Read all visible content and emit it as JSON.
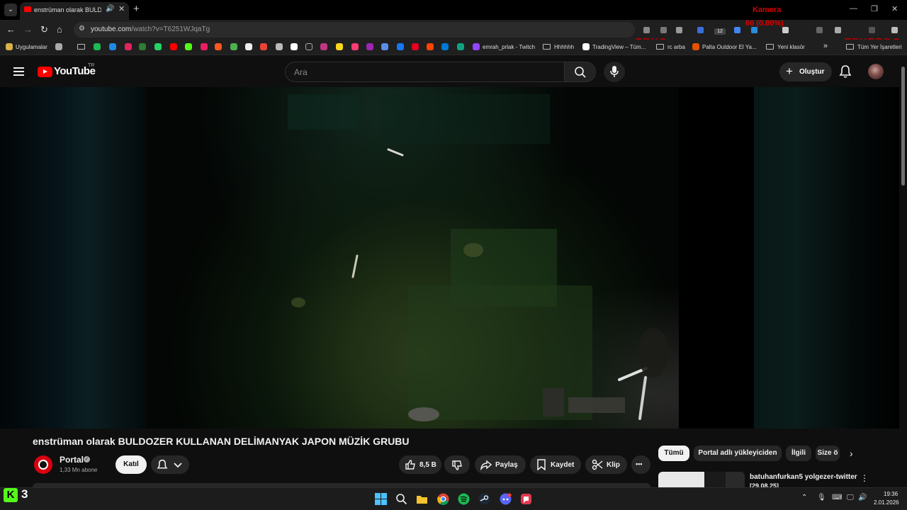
{
  "browser": {
    "tab_title": "enstrüman olarak BULDOZER KULLANAN",
    "url_host": "youtube.com",
    "url_path": "/watch?v=T6251WJqaTg",
    "overlay_camera": "Kamera",
    "overlay_stat": "06 (0.00%)",
    "overlay_left": "TRYO",
    "overlay_right": "TRYERDO",
    "ext_badge": "12"
  },
  "bookmarks": {
    "apps": "Uygulamalar",
    "twitch": "emrah_prlak - Twitch",
    "hhhhhh": "Hhhhhh",
    "tradingview": "TradingView – Tüm...",
    "rc_arba": "rc arba",
    "palta": "Palta Outdoor El Ya...",
    "yeni_klasor": "Yeni klasör",
    "more": "»",
    "all_bookmarks": "Tüm Yer İşaretleri"
  },
  "youtube": {
    "logo_text": "YouTube",
    "country": "TR",
    "search_placeholder": "Ara",
    "create_label": "Oluştur"
  },
  "video": {
    "title": "enstrüman olarak BULDOZER KULLANAN DELİMANYAK JAPON MÜZİK GRUBU",
    "channel": "Portal",
    "subscribers": "1,33 Mn abone",
    "join_label": "Katıl",
    "likes": "8,5 B",
    "share_label": "Paylaş",
    "save_label": "Kaydet",
    "clip_label": "Klip",
    "more_label": "•••"
  },
  "chips": [
    "Tümü",
    "Portal adlı yükleyiciden",
    "İlgili",
    "Size ö"
  ],
  "recommendation": {
    "title": "batuhanfurkan5 yolgezer-twitter",
    "subtitle": "[29.08.25]"
  },
  "taskbar": {
    "kick_count": "3",
    "time": "19:36",
    "date": "2.01.2026"
  },
  "colors": {
    "youtube_red": "#ff0000",
    "background": "#0f0f0f",
    "overlay_red": "#d90000",
    "kick_green": "#53fc18"
  }
}
